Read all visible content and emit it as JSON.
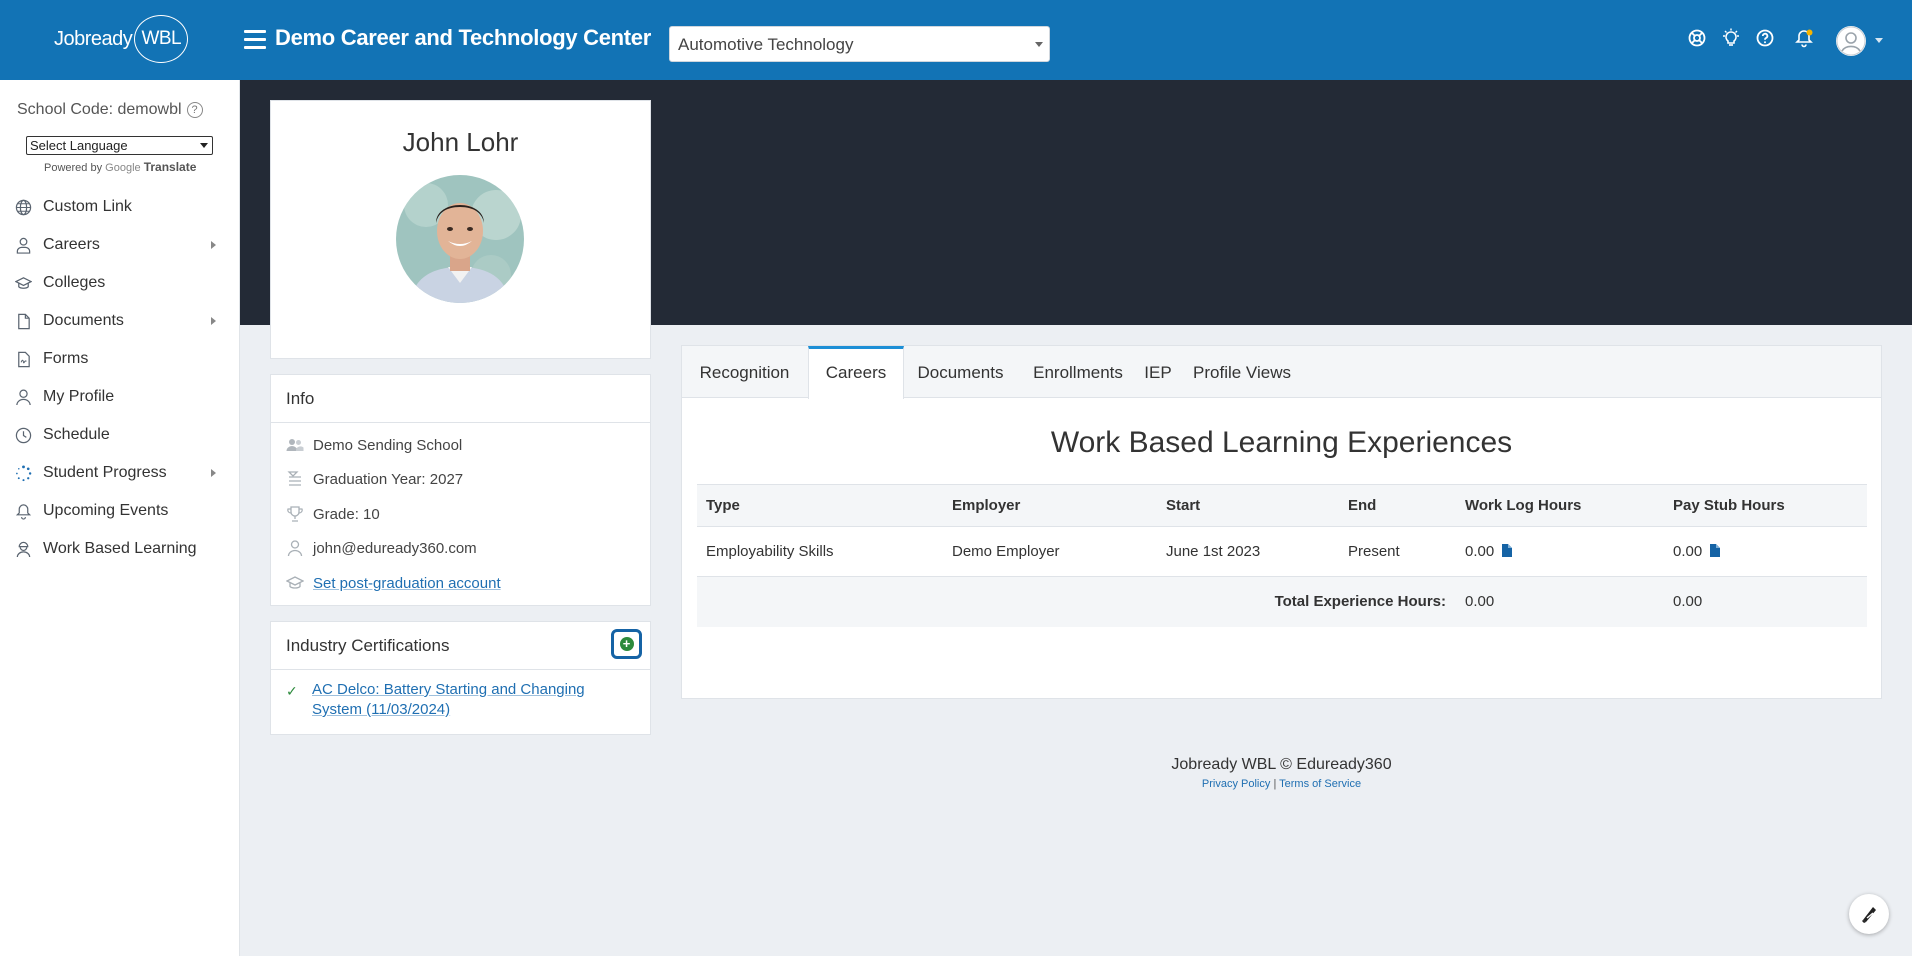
{
  "header": {
    "logo_text": "Jobready",
    "logo_badge": "WBL",
    "org_title": "Demo Career and Technology Center",
    "program_select_value": "Automotive Technology",
    "icons": [
      "support-icon",
      "lightbulb-icon",
      "help-icon",
      "bell-icon",
      "user-avatar-icon"
    ]
  },
  "sidebar": {
    "school_code": "School Code: demowbl",
    "language_select": "Select Language",
    "powered_by": "Powered by",
    "google": "Google",
    "translate": "Translate",
    "items": [
      {
        "label": "Custom Link",
        "icon": "globe-icon",
        "expandable": false
      },
      {
        "label": "Careers",
        "icon": "careers-icon",
        "expandable": true
      },
      {
        "label": "Colleges",
        "icon": "graduation-cap-icon",
        "expandable": false
      },
      {
        "label": "Documents",
        "icon": "document-icon",
        "expandable": true
      },
      {
        "label": "Forms",
        "icon": "form-icon",
        "expandable": false
      },
      {
        "label": "My Profile",
        "icon": "user-icon",
        "expandable": false
      },
      {
        "label": "Schedule",
        "icon": "clock-icon",
        "expandable": false
      },
      {
        "label": "Student Progress",
        "icon": "spinner-icon",
        "expandable": true
      },
      {
        "label": "Upcoming Events",
        "icon": "bell-icon",
        "expandable": false
      },
      {
        "label": "Work Based Learning",
        "icon": "worker-icon",
        "expandable": false
      }
    ]
  },
  "profile": {
    "name": "John Lohr"
  },
  "info": {
    "heading": "Info",
    "school": "Demo Sending School",
    "graduation": "Graduation Year: 2027",
    "grade": "Grade: 10",
    "email": "john@eduready360.com",
    "post_grad_link": "Set post-graduation account"
  },
  "certifications": {
    "heading": "Industry Certifications",
    "items": [
      "AC Delco: Battery Starting and Changing",
      "System (11/03/2024)"
    ]
  },
  "tabs": [
    "Recognition",
    "Careers",
    "Documents",
    "Enrollments",
    "IEP",
    "Profile Views"
  ],
  "active_tab": "Careers",
  "wbl": {
    "title": "Work Based Learning Experiences",
    "columns": [
      "Type",
      "Employer",
      "Start",
      "End",
      "Work Log Hours",
      "Pay Stub Hours"
    ],
    "rows": [
      [
        "Employability Skills",
        "Demo Employer",
        "June 1st 2023",
        "Present",
        "0.00",
        "0.00"
      ]
    ],
    "total_label": "Total Experience Hours:",
    "total_work_log": "0.00",
    "total_pay_stub": "0.00"
  },
  "footer": {
    "copyright": "Jobready WBL © Eduready360",
    "privacy": "Privacy Policy",
    "separator": "|",
    "terms": "Terms of Service"
  },
  "colors": {
    "header_bg": "#1273b5",
    "banner_bg": "#232a36",
    "link": "#1f6fb2",
    "active_tab_border": "#1d8fd6",
    "add_button_border": "#1563a5",
    "add_button_fill": "#2c8a3c"
  }
}
